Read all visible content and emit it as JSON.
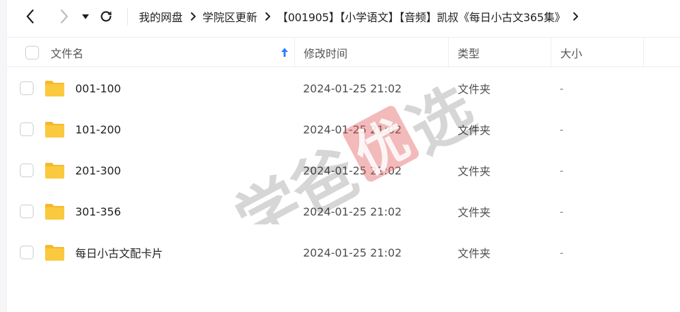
{
  "breadcrumb": [
    "我的网盘",
    "学院区更新",
    "【001905】【小学语文】【音频】凯叔《每日小古文365集》"
  ],
  "header": {
    "name": "文件名",
    "modified": "修改时间",
    "type": "类型",
    "size": "大小"
  },
  "files": [
    {
      "name": "001-100",
      "modified": "2024-01-25 21:02",
      "type": "文件夹",
      "size": "-"
    },
    {
      "name": "101-200",
      "modified": "2024-01-25 21:02",
      "type": "文件夹",
      "size": "-"
    },
    {
      "name": "201-300",
      "modified": "2024-01-25 21:02",
      "type": "文件夹",
      "size": "-"
    },
    {
      "name": "301-356",
      "modified": "2024-01-25 21:02",
      "type": "文件夹",
      "size": "-"
    },
    {
      "name": "每日小古文配卡片",
      "modified": "2024-01-25 21:02",
      "type": "文件夹",
      "size": "-"
    }
  ],
  "watermark": {
    "text1": "学",
    "text2": "爸",
    "seal": "优",
    "text3": "选"
  },
  "colors": {
    "folder": "#fbc93d",
    "folder_tab": "#f6b82c",
    "accent": "#2f7fff",
    "seal": "#e05a5a"
  }
}
